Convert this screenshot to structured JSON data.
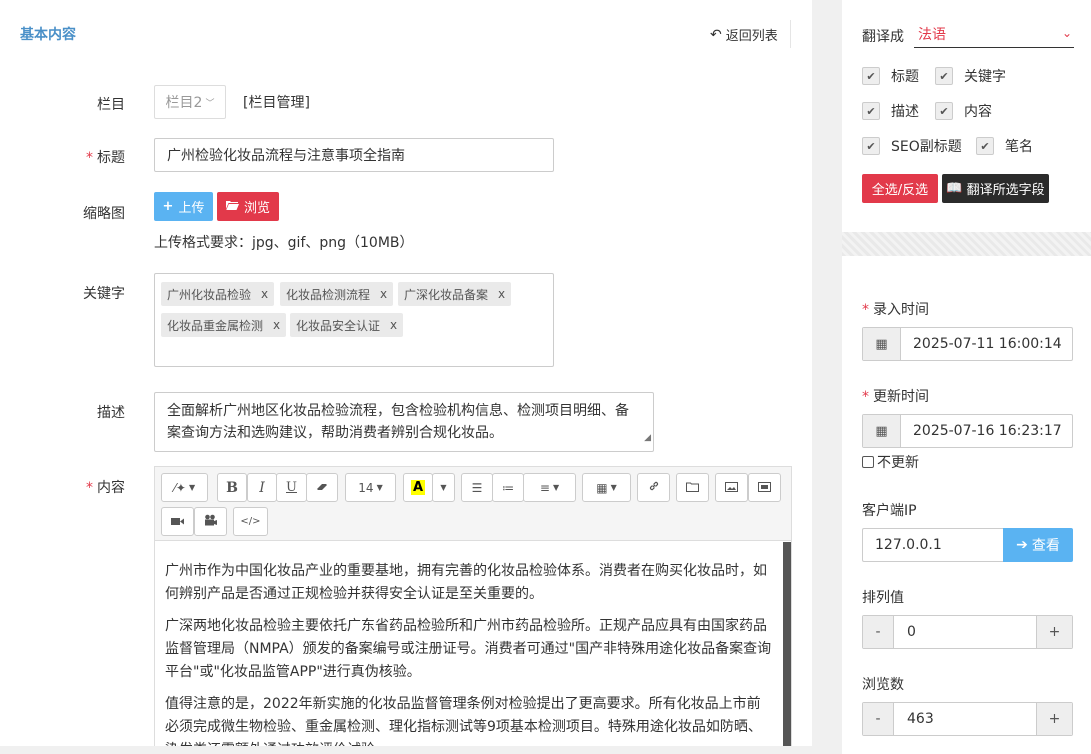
{
  "header": {
    "title": "基本内容",
    "back_label": "返回列表"
  },
  "form": {
    "column": {
      "label": "栏目",
      "value": "栏目2",
      "manage_link": "[栏目管理]"
    },
    "title": {
      "label": "标题",
      "value": "广州检验化妆品流程与注意事项全指南"
    },
    "thumbnail": {
      "label": "缩略图",
      "upload_label": "上传",
      "browse_label": "浏览",
      "hint": "上传格式要求：jpg、gif、png（10MB）"
    },
    "keywords": {
      "label": "关键字",
      "tags": [
        "广州化妆品检验",
        "化妆品检测流程",
        "广深化妆品备案",
        "化妆品重金属检测",
        "化妆品安全认证"
      ],
      "remove_glyph": "x"
    },
    "description": {
      "label": "描述",
      "value": "全面解析广州地区化妆品检验流程，包含检验机构信息、检测项目明细、备案查询方法和选购建议，帮助消费者辨别合规化妆品。"
    },
    "content": {
      "label": "内容",
      "font_size": "14",
      "paragraphs": [
        "广州市作为中国化妆品产业的重要基地，拥有完善的化妆品检验体系。消费者在购买化妆品时，如何辨别产品是否通过正规检验并获得安全认证是至关重要的。",
        "广深两地化妆品检验主要依托广东省药品检验所和广州市药品检验所。正规产品应具有由国家药品监督管理局（NMPA）颁发的备案编号或注册证号。消费者可通过\"国产非特殊用途化妆品备案查询平台\"或\"化妆品监管APP\"进行真伪核验。",
        "值得注意的是，2022年新实施的化妆品监督管理条例对检验提出了更高要求。所有化妆品上市前必须完成微生物检验、重金属检测、理化指标测试等9项基本检测项目。特殊用途化妆品如防晒、染发类还需额外通过功效评价试验。"
      ]
    }
  },
  "translate": {
    "label": "翻译成",
    "language": "法语",
    "fields": [
      {
        "label": "标题",
        "checked": true
      },
      {
        "label": "关键字",
        "checked": true
      },
      {
        "label": "描述",
        "checked": true
      },
      {
        "label": "内容",
        "checked": true
      },
      {
        "label": "SEO副标题",
        "checked": true
      },
      {
        "label": "笔名",
        "checked": true
      }
    ],
    "select_all_label": "全选/反选",
    "translate_label": "翻译所选字段"
  },
  "meta": {
    "created": {
      "label": "录入时间",
      "value": "2025-07-11 16:00:14"
    },
    "updated": {
      "label": "更新时间",
      "value": "2025-07-16 16:23:17"
    },
    "no_update_label": "不更新",
    "client_ip": {
      "label": "客户端IP",
      "value": "127.0.0.1",
      "lookup_label": "查看"
    },
    "sort": {
      "label": "排列值",
      "value": "0"
    },
    "views": {
      "label": "浏览数",
      "value": "463"
    }
  },
  "colors": {
    "accent_blue": "#5ab3f2",
    "accent_red": "#e2394a",
    "title_blue": "#4a90c8",
    "dark_button": "#2b2b2b"
  }
}
